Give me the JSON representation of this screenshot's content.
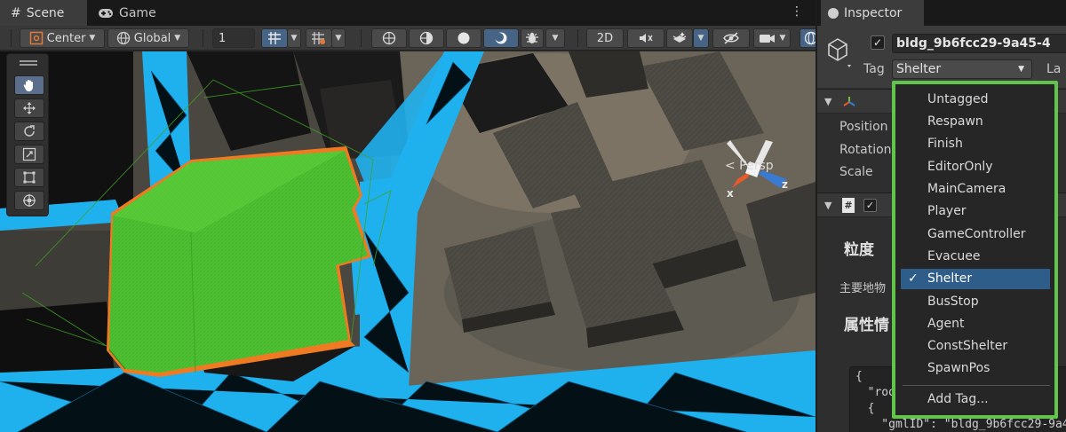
{
  "scene": {
    "tabs": [
      {
        "label": "Scene",
        "icon": "grid-hash-icon"
      },
      {
        "label": "Game",
        "icon": "gamepad-icon"
      }
    ],
    "toolbar": {
      "pivot_label": "Center",
      "space_label": "Global",
      "grid_size": "1",
      "mode_2d_label": "2D"
    },
    "view_label": "< Persp",
    "gizmo_axes": {
      "x": "x",
      "z": "z"
    }
  },
  "inspector": {
    "tab_label": "Inspector",
    "object_name": "bldg_9b6fcc29-9a45-4",
    "tag_label": "Tag",
    "tag_value": "Shelter",
    "layer_label_cut": "La",
    "transform": {
      "position_label": "Position",
      "rotation_label": "Rotation",
      "scale_label": "Scale"
    },
    "script_section": {
      "heading_granularity": "粒度",
      "sub_label": "主要地物",
      "heading_attributes": "属性情"
    },
    "json_preview": [
      "{",
      "  \"root",
      "  {",
      "    \"gmlID\": \"bldg_9b6fcc29-9a4"
    ]
  },
  "tag_menu": {
    "items": [
      "Untagged",
      "Respawn",
      "Finish",
      "EditorOnly",
      "MainCamera",
      "Player",
      "GameController",
      "Evacuee",
      "Shelter",
      "BusStop",
      "Agent",
      "ConstShelter",
      "SpawnPos"
    ],
    "selected": "Shelter",
    "check_mark": "✓",
    "add_label": "Add Tag..."
  },
  "colors": {
    "highlight_border": "#62c44a",
    "selected_building": "#4ec132",
    "navmesh": "#1fb1ee",
    "menu_selection": "#2e5d8a"
  }
}
